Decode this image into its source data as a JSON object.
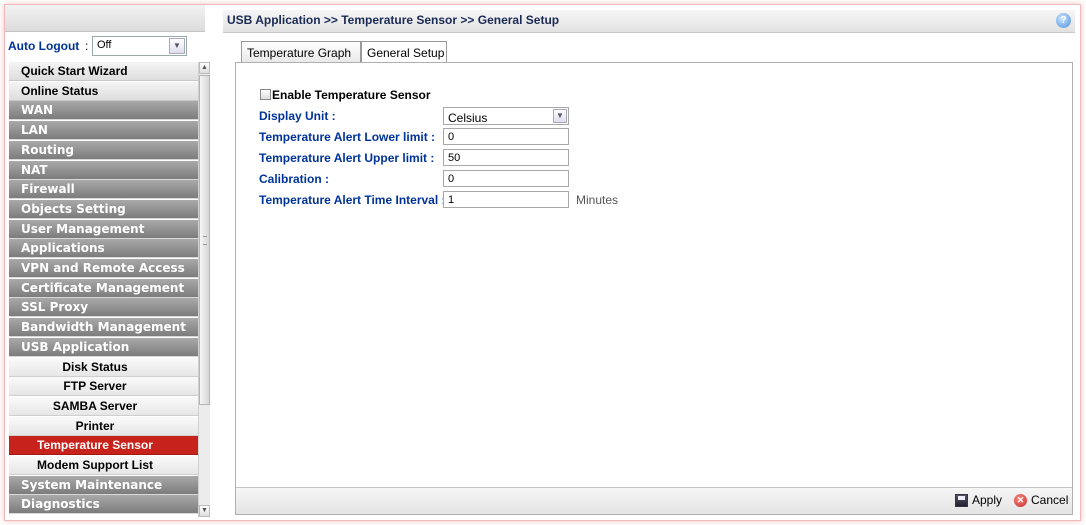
{
  "sidebar": {
    "auto_logout": {
      "label": "Auto Logout",
      "colon": ":",
      "value": "Off"
    },
    "menu": [
      {
        "label": "Quick Start Wizard",
        "style": "light"
      },
      {
        "label": "Online Status",
        "style": "light"
      },
      {
        "label": "WAN",
        "style": "dark"
      },
      {
        "label": "LAN",
        "style": "dark"
      },
      {
        "label": "Routing",
        "style": "dark"
      },
      {
        "label": "NAT",
        "style": "dark"
      },
      {
        "label": "Firewall",
        "style": "dark"
      },
      {
        "label": "Objects Setting",
        "style": "dark"
      },
      {
        "label": "User Management",
        "style": "dark"
      },
      {
        "label": "Applications",
        "style": "dark"
      },
      {
        "label": "VPN and Remote Access",
        "style": "dark"
      },
      {
        "label": "Certificate Management",
        "style": "dark"
      },
      {
        "label": "SSL Proxy",
        "style": "dark"
      },
      {
        "label": "Bandwidth Management",
        "style": "dark"
      },
      {
        "label": "USB Application",
        "style": "dark"
      },
      {
        "label": "Disk Status",
        "style": "sub"
      },
      {
        "label": "FTP Server",
        "style": "sub"
      },
      {
        "label": "SAMBA Server",
        "style": "sub"
      },
      {
        "label": "Printer",
        "style": "sub"
      },
      {
        "label": "Temperature Sensor",
        "style": "sub-active"
      },
      {
        "label": "Modem Support List",
        "style": "sub"
      },
      {
        "label": "System Maintenance",
        "style": "dark"
      },
      {
        "label": "Diagnostics",
        "style": "dark"
      }
    ]
  },
  "main": {
    "breadcrumb": "USB Application >> Temperature Sensor >> General Setup",
    "help_icon": "?",
    "tabs": [
      {
        "label": "Temperature Graph",
        "active": false
      },
      {
        "label": "General Setup",
        "active": true
      }
    ],
    "form": {
      "enable_label": "Enable Temperature Sensor",
      "enable_checked": false,
      "display_unit_label": "Display Unit :",
      "display_unit_value": "Celsius",
      "lower_limit_label": "Temperature Alert Lower limit :",
      "lower_limit_value": "0",
      "upper_limit_label": "Temperature Alert Upper limit :",
      "upper_limit_value": "50",
      "calibration_label": "Calibration :",
      "calibration_value": "0",
      "interval_label": "Temperature Alert Time Interval :",
      "interval_value": "1",
      "interval_unit": "Minutes"
    },
    "footer": {
      "apply_label": "Apply",
      "cancel_label": "Cancel"
    }
  },
  "colors": {
    "accent_red": "#c8221c",
    "label_blue": "#003399",
    "menu_dark": "#8a8a8a"
  }
}
